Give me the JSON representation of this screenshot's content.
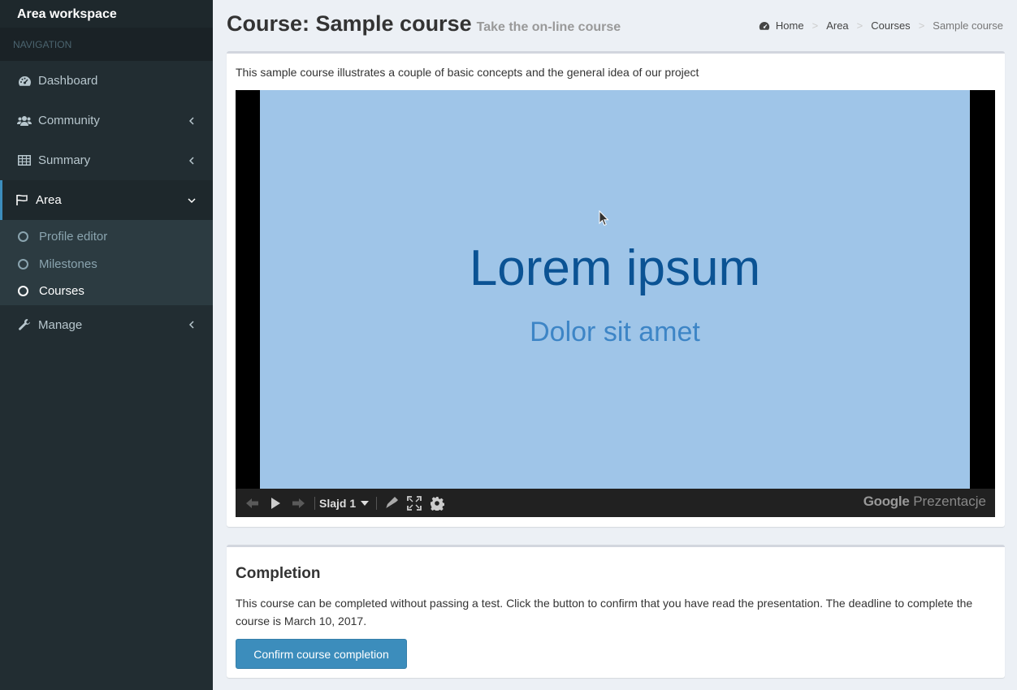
{
  "sidebar": {
    "brand": "Area workspace",
    "nav_header": "Navigation",
    "items": [
      {
        "label": "Dashboard",
        "icon": "dashboard-icon"
      },
      {
        "label": "Community",
        "icon": "users-icon"
      },
      {
        "label": "Summary",
        "icon": "table-icon"
      },
      {
        "label": "Area",
        "icon": "flag-icon"
      },
      {
        "label": "Manage",
        "icon": "wrench-icon"
      }
    ],
    "submenu": [
      "Profile editor",
      "Milestones",
      "Courses"
    ]
  },
  "header": {
    "title": "Course: Sample course",
    "subtitle": "Take the on-line course"
  },
  "breadcrumb": [
    "Home",
    "Area",
    "Courses",
    "Sample course"
  ],
  "course": {
    "description": "This sample course illustrates a couple of basic concepts and the general idea of our project"
  },
  "presentation": {
    "slide_title": "Lorem ipsum",
    "slide_subtitle": "Dolor sit amet",
    "slide_selector": "Slajd 1",
    "brand_google": "Google",
    "brand_product": "Prezentacje"
  },
  "completion": {
    "title": "Completion",
    "text": "This course can be completed without passing a test. Click the button to confirm that you have read the presentation. The deadline to complete the course is March 10, 2017.",
    "button": "Confirm course completion"
  },
  "colors": {
    "sidebar_bg": "#222d32",
    "accent": "#3c8dbc",
    "slide_bg": "#9fc5e8",
    "slide_title": "#0b5394"
  }
}
